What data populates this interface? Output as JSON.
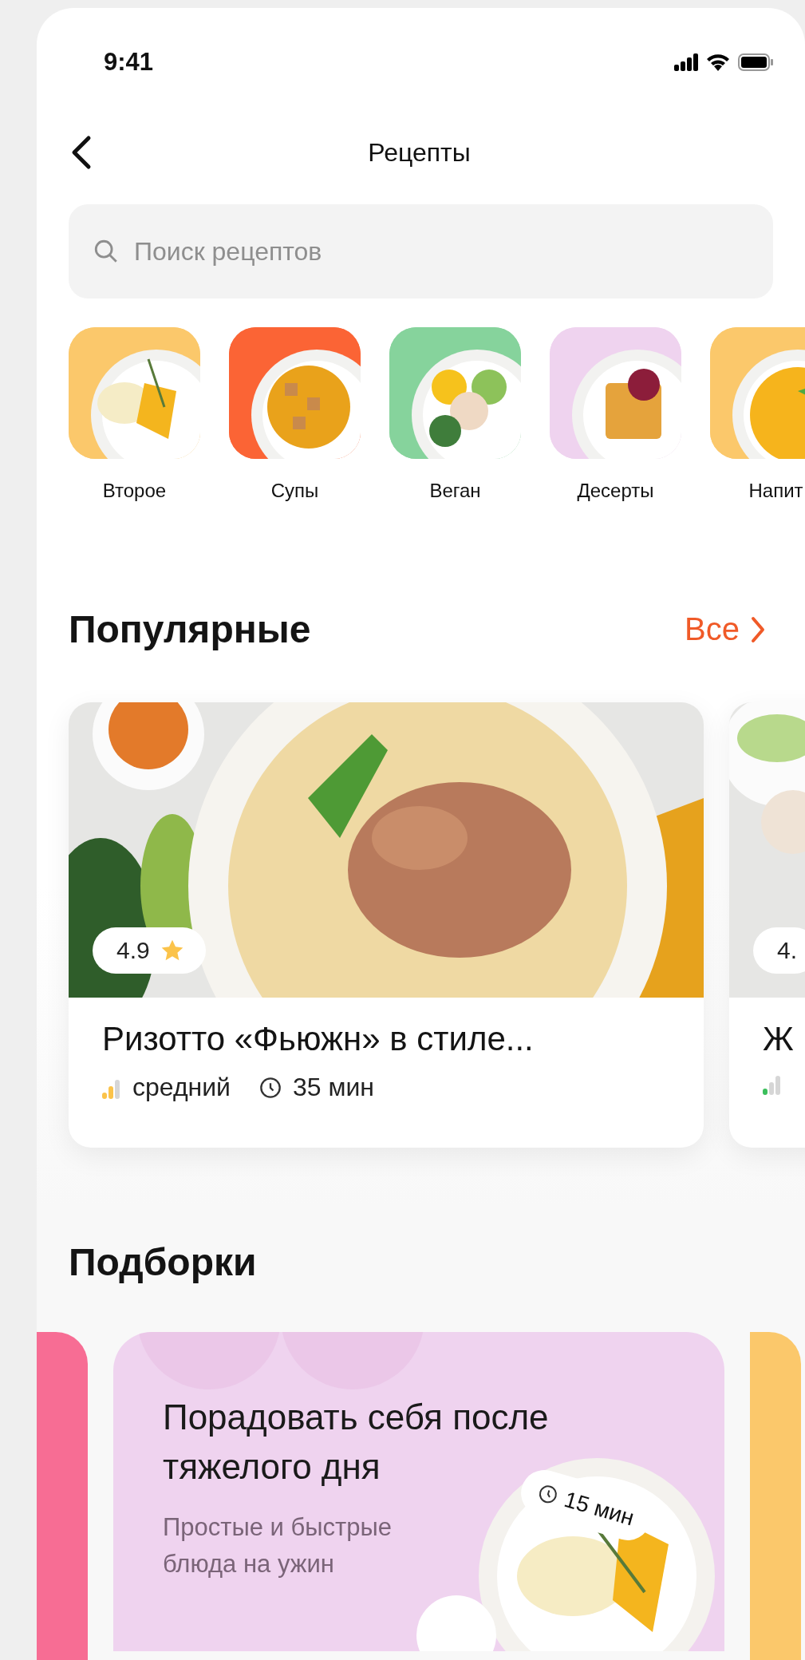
{
  "status_bar": {
    "time": "9:41"
  },
  "header": {
    "title": "Рецепты"
  },
  "search": {
    "placeholder": "Поиск рецептов"
  },
  "categories": [
    {
      "label": "Второе",
      "color": "#fbc86b"
    },
    {
      "label": "Супы",
      "color": "#fb6435"
    },
    {
      "label": "Веган",
      "color": "#86d39c"
    },
    {
      "label": "Десерты",
      "color": "#efd3ef"
    },
    {
      "label": "Напит",
      "color": "#fbc86b"
    }
  ],
  "popular": {
    "title": "Популярные",
    "link": "Все",
    "recipes": [
      {
        "title": "Ризотто «Фьюжн» в стиле...",
        "rating": "4.9",
        "star_shown": true,
        "difficulty": "средний",
        "level": 0.67,
        "time": "35 мин"
      },
      {
        "title": "Ж",
        "rating": "4.",
        "star_shown": false,
        "level": 0.33
      }
    ]
  },
  "collections": {
    "title": "Подборки",
    "cards": [
      {
        "title": "Порадовать себя после тяжелого дня",
        "subtitle": "Простые и быстрые блюда на ужин",
        "time": "15 мин"
      }
    ]
  }
}
